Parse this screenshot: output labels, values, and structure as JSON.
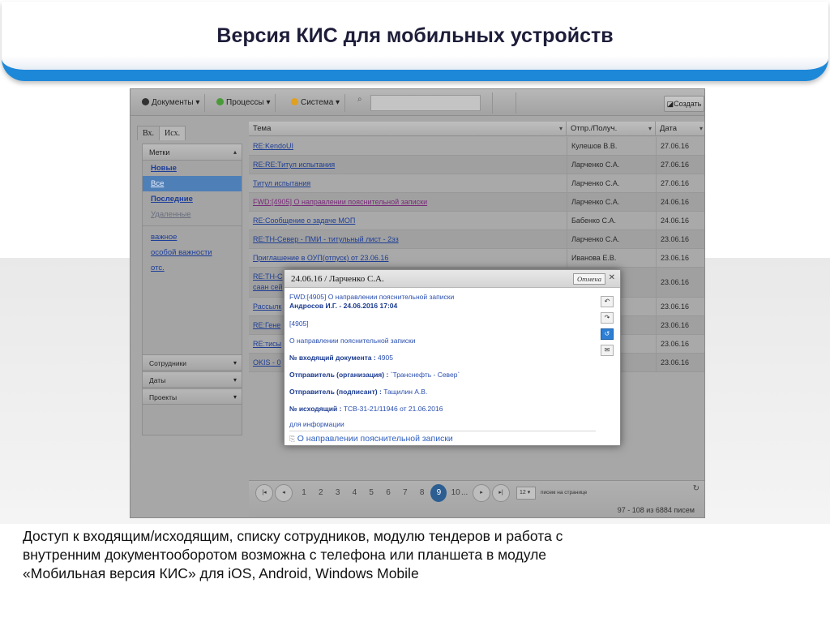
{
  "slide": {
    "title": "Версия КИС для мобильных устройств",
    "caption": [
      "Доступ к входящим/исходящим, списку сотрудников, модулю тендеров и работа с",
      "внутренним документооборотом возможна с телефона или планшета в модуле",
      "«Мобильная версия КИС» для iOS, Android, Windows Mobile"
    ]
  },
  "toolbar": {
    "menus": [
      {
        "label": "Документы ▾",
        "icon": "documents-icon",
        "color": "#333333"
      },
      {
        "label": "Процессы ▾",
        "icon": "processes-icon",
        "color": "#4a9a3a"
      },
      {
        "label": "Система ▾",
        "icon": "system-icon",
        "color": "#e0a020"
      }
    ],
    "search_value": "",
    "create_label": "Создать"
  },
  "sidebar": {
    "tabs": [
      "Вх.",
      "Исх."
    ],
    "labels_header": "Метки",
    "links": [
      {
        "label": "Новые",
        "style": "bold"
      },
      {
        "label": "Все",
        "style": "selected"
      },
      {
        "label": "Последние",
        "style": "bold"
      },
      {
        "label": "Удаленные",
        "style": "muted"
      },
      {
        "label": "важное",
        "style": "normal"
      },
      {
        "label": "особой важности",
        "style": "normal"
      },
      {
        "label": "отс.",
        "style": "normal"
      }
    ],
    "sections": [
      "Сотрудники",
      "Даты",
      "Проекты"
    ]
  },
  "grid": {
    "columns": [
      "Тема",
      "Отпр./Получ.",
      "Дата"
    ],
    "rows": [
      {
        "subject": "RE:KendoUI",
        "from": "Кулешов В.В.",
        "date": "27.06.16",
        "visited": false
      },
      {
        "subject": "RE:RE:Титул испытания",
        "from": "Ларченко С.А.",
        "date": "27.06.16",
        "visited": false
      },
      {
        "subject": "Титул испытания",
        "from": "Ларченко С.А.",
        "date": "27.06.16",
        "visited": false
      },
      {
        "subject": "FWD:[4905] О направлении пояснительной записки",
        "from": "Ларченко С.А.",
        "date": "24.06.16",
        "visited": true
      },
      {
        "subject": "RE:Сообщение о задаче МОП",
        "from": "Бабенко С.А.",
        "date": "24.06.16",
        "visited": false
      },
      {
        "subject": "RE:TH-Север - ПМИ - титульный лист - 2эз",
        "from": "Ларченко С.А.",
        "date": "23.06.16",
        "visited": false
      },
      {
        "subject": "Приглашение в ОУП(отпуск) от 23.06.16",
        "from": "Иванова Е.В.",
        "date": "23.06.16",
        "visited": false
      },
      {
        "subject": "RE:TH-С",
        "subject2": "саан сей",
        "from": "",
        "date": "23.06.16",
        "visited": false
      },
      {
        "subject": "Рассылк",
        "from": "",
        "date": "23.06.16",
        "visited": false
      },
      {
        "subject": "RE:Гене",
        "from": "",
        "date": "23.06.16",
        "visited": false
      },
      {
        "subject": "RE:тисы",
        "from": "",
        "date": "23.06.16",
        "visited": false
      },
      {
        "subject": "OKIS - 0",
        "from": "",
        "date": "23.06.16",
        "visited": false
      }
    ]
  },
  "pager": {
    "pages": [
      "1",
      "2",
      "3",
      "4",
      "5",
      "6",
      "7",
      "8",
      "9",
      "10"
    ],
    "current": "9",
    "dots": "...",
    "page_size": "12 ▾",
    "page_size_label": "писем на странице",
    "count": "97 - 108 из 6884 писем"
  },
  "popup": {
    "title": "24.06.16 / Ларченко С.А.",
    "cancel_label": "Отмена",
    "close": "✕",
    "subject": "FWD:[4905] О направлении пояснительной записки",
    "author": "Андросов И.Г. - 24.06.2016 17:04",
    "ref": "[4905]",
    "topic": "О направлении пояснительной записки",
    "incoming_label": "№ входящий документа :",
    "incoming_value": " 4905",
    "sender_org_label": "Отправитель (организация) :",
    "sender_org_value": " `Транснефть - Север`",
    "signer_label": "Отправитель (подписант) :",
    "signer_value": " Тащилин А.В.",
    "outgoing_label": "№ исходящий :",
    "outgoing_value": " ТСВ-31-21/11946 от 21.06.2016",
    "note": "для информации",
    "attachment": "О направлении пояснительной записки"
  }
}
